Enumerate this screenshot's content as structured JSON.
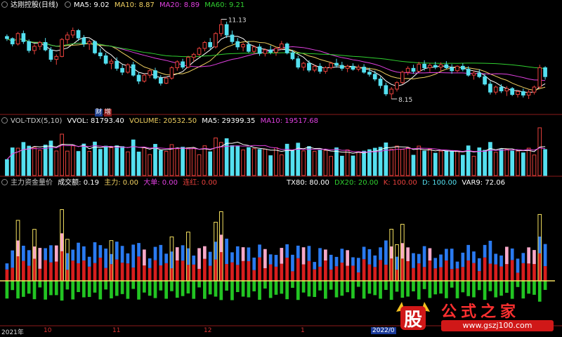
{
  "price_header": {
    "title": "达刚控股(日线)",
    "ma5": "MA5: 9.02",
    "ma10": "MA10: 8.87",
    "ma20": "MA20: 8.89",
    "ma60": "MA60: 9.21"
  },
  "vol_header": {
    "title": "VOL-TDX(5,10)",
    "vvol": "VVOL: 81793.40",
    "volume": "VOLUME: 20532.50",
    "ma5": "MA5: 29399.35",
    "ma10": "MA10: 19517.68"
  },
  "flow_header": {
    "title": "主力资金量价",
    "cje": "成交额: 0.19",
    "zl": "主力: 0.00",
    "dd": "大单: 0.00",
    "lh": "连红: 0.00",
    "tx80": "TX80: 80.00",
    "dx20": "DX20: 20.00",
    "k": "K: 100.00",
    "d": "D: 100.00",
    "var9": "VAR9: 72.06"
  },
  "badges": {
    "cai": "财",
    "zeng": "增"
  },
  "x_ticks": [
    "2021年",
    "10",
    "11",
    "12",
    "1",
    "2022/0"
  ],
  "logo": {
    "char": "股",
    "text": "公式之家",
    "url": "www.gszj100.com"
  },
  "colors": {
    "up": "#e8413c",
    "down": "#54e0f0",
    "ma5": "#ffffff",
    "ma10": "#f0d060",
    "ma20": "#e040e0",
    "ma60": "#30d030",
    "flow_red": "#d81e1e",
    "flow_blue": "#2a7af0",
    "flow_green": "#22c422",
    "flow_pink": "#f8a8c8",
    "flow_yellow": "#f4e060"
  },
  "chart_data": [
    {
      "type": "candlestick",
      "title": "达刚控股(日线)",
      "annotations": [
        {
          "label": "11.13",
          "kind": "high"
        },
        {
          "label": "8.15",
          "kind": "low"
        }
      ],
      "ylim": [
        8.0,
        11.4
      ],
      "series_names": [
        "MA5",
        "MA10",
        "MA20",
        "MA60"
      ],
      "ohlc": [
        [
          10.55,
          10.62,
          10.4,
          10.48
        ],
        [
          10.48,
          10.52,
          10.22,
          10.3
        ],
        [
          10.3,
          10.7,
          10.25,
          10.65
        ],
        [
          10.65,
          10.75,
          10.3,
          10.38
        ],
        [
          10.38,
          10.45,
          10.0,
          10.08
        ],
        [
          10.08,
          10.3,
          9.95,
          10.22
        ],
        [
          10.22,
          10.4,
          10.1,
          10.35
        ],
        [
          10.35,
          10.5,
          10.05,
          10.1
        ],
        [
          10.1,
          10.2,
          9.7,
          9.78
        ],
        [
          9.78,
          9.95,
          9.6,
          9.88
        ],
        [
          9.88,
          10.5,
          9.85,
          10.45
        ],
        [
          10.45,
          10.7,
          10.3,
          10.6
        ],
        [
          10.6,
          10.85,
          10.5,
          10.75
        ],
        [
          10.75,
          10.8,
          10.4,
          10.5
        ],
        [
          10.5,
          10.6,
          10.2,
          10.3
        ],
        [
          10.3,
          10.45,
          10.1,
          10.38
        ],
        [
          10.38,
          10.42,
          9.95,
          10.0
        ],
        [
          10.0,
          10.15,
          9.8,
          9.9
        ],
        [
          9.9,
          10.0,
          9.6,
          9.65
        ],
        [
          9.65,
          9.8,
          9.45,
          9.72
        ],
        [
          9.72,
          9.85,
          9.4,
          9.48
        ],
        [
          9.48,
          9.6,
          9.25,
          9.35
        ],
        [
          9.35,
          9.65,
          9.3,
          9.6
        ],
        [
          9.6,
          9.7,
          9.2,
          9.25
        ],
        [
          9.25,
          9.35,
          8.95,
          9.05
        ],
        [
          9.05,
          9.3,
          9.0,
          9.25
        ],
        [
          9.25,
          9.45,
          9.15,
          9.4
        ],
        [
          9.4,
          9.5,
          9.1,
          9.15
        ],
        [
          9.15,
          9.25,
          8.9,
          8.98
        ],
        [
          8.98,
          9.2,
          8.95,
          9.15
        ],
        [
          9.15,
          9.55,
          9.1,
          9.5
        ],
        [
          9.5,
          9.75,
          9.4,
          9.7
        ],
        [
          9.7,
          9.8,
          9.45,
          9.52
        ],
        [
          9.52,
          9.9,
          9.48,
          9.85
        ],
        [
          9.85,
          10.0,
          9.7,
          9.95
        ],
        [
          9.95,
          10.2,
          9.9,
          10.15
        ],
        [
          10.15,
          10.4,
          10.05,
          10.35
        ],
        [
          10.35,
          10.5,
          10.1,
          10.2
        ],
        [
          10.2,
          10.7,
          10.15,
          10.65
        ],
        [
          10.65,
          11.13,
          10.55,
          10.95
        ],
        [
          10.95,
          11.05,
          10.5,
          10.6
        ],
        [
          10.6,
          10.75,
          10.3,
          10.38
        ],
        [
          10.38,
          10.5,
          10.1,
          10.2
        ],
        [
          10.2,
          10.35,
          10.05,
          10.28
        ],
        [
          10.28,
          10.4,
          10.0,
          10.05
        ],
        [
          10.05,
          10.25,
          9.95,
          10.2
        ],
        [
          10.2,
          10.3,
          9.9,
          9.98
        ],
        [
          9.98,
          10.15,
          9.88,
          10.1
        ],
        [
          10.1,
          10.25,
          9.95,
          10.02
        ],
        [
          10.02,
          10.2,
          9.9,
          10.15
        ],
        [
          10.15,
          10.4,
          10.1,
          10.3
        ],
        [
          10.3,
          10.35,
          9.95,
          10.0
        ],
        [
          10.0,
          10.1,
          9.75,
          9.8
        ],
        [
          9.8,
          9.9,
          9.45,
          9.52
        ],
        [
          9.52,
          9.7,
          9.4,
          9.65
        ],
        [
          9.65,
          9.75,
          9.35,
          9.42
        ],
        [
          9.42,
          9.6,
          9.35,
          9.55
        ],
        [
          9.55,
          9.65,
          9.3,
          9.38
        ],
        [
          9.38,
          9.55,
          9.3,
          9.5
        ],
        [
          9.5,
          9.7,
          9.45,
          9.65
        ],
        [
          9.65,
          9.8,
          9.5,
          9.58
        ],
        [
          9.58,
          9.7,
          9.4,
          9.48
        ],
        [
          9.48,
          9.6,
          9.35,
          9.55
        ],
        [
          9.55,
          9.65,
          9.4,
          9.45
        ],
        [
          9.45,
          9.6,
          9.38,
          9.52
        ],
        [
          9.52,
          9.62,
          9.3,
          9.35
        ],
        [
          9.35,
          9.5,
          9.2,
          9.28
        ],
        [
          9.28,
          9.4,
          9.05,
          9.12
        ],
        [
          9.12,
          9.2,
          8.8,
          8.9
        ],
        [
          8.9,
          9.0,
          8.55,
          8.62
        ],
        [
          8.62,
          8.85,
          8.45,
          8.78
        ],
        [
          8.78,
          9.05,
          8.7,
          9.0
        ],
        [
          9.0,
          9.4,
          8.95,
          9.35
        ],
        [
          9.35,
          9.55,
          9.25,
          9.48
        ],
        [
          9.48,
          9.6,
          9.3,
          9.38
        ],
        [
          9.38,
          9.7,
          9.35,
          9.62
        ],
        [
          9.62,
          9.75,
          9.4,
          9.5
        ],
        [
          9.5,
          9.65,
          9.35,
          9.58
        ],
        [
          9.58,
          9.7,
          9.45,
          9.52
        ],
        [
          9.52,
          9.68,
          9.4,
          9.6
        ],
        [
          9.6,
          9.72,
          9.45,
          9.5
        ],
        [
          9.5,
          9.62,
          9.3,
          9.4
        ],
        [
          9.4,
          9.58,
          9.35,
          9.55
        ],
        [
          9.55,
          9.65,
          9.38,
          9.45
        ],
        [
          9.45,
          9.55,
          9.2,
          9.25
        ],
        [
          9.25,
          9.4,
          9.1,
          9.32
        ],
        [
          9.32,
          9.45,
          9.15,
          9.2
        ],
        [
          9.2,
          9.3,
          8.9,
          8.95
        ],
        [
          8.95,
          9.05,
          8.6,
          8.68
        ],
        [
          8.68,
          8.9,
          8.6,
          8.85
        ],
        [
          8.85,
          8.95,
          8.65,
          8.72
        ],
        [
          8.72,
          8.88,
          8.55,
          8.8
        ],
        [
          8.8,
          8.85,
          8.55,
          8.6
        ],
        [
          8.6,
          8.75,
          8.5,
          8.7
        ],
        [
          8.7,
          8.8,
          8.5,
          8.58
        ],
        [
          8.58,
          8.75,
          8.45,
          8.68
        ],
        [
          8.68,
          8.9,
          8.6,
          8.85
        ],
        [
          8.85,
          9.6,
          8.8,
          9.5
        ],
        [
          9.5,
          9.55,
          9.1,
          9.2
        ]
      ]
    },
    {
      "type": "bar",
      "title": "VOL-TDX(5,10)",
      "series_names": [
        "VOLUME",
        "MA5",
        "MA10"
      ]
    },
    {
      "type": "bar",
      "title": "主力资金量价",
      "series_names": [
        "主力",
        "大单",
        "连红"
      ]
    }
  ]
}
